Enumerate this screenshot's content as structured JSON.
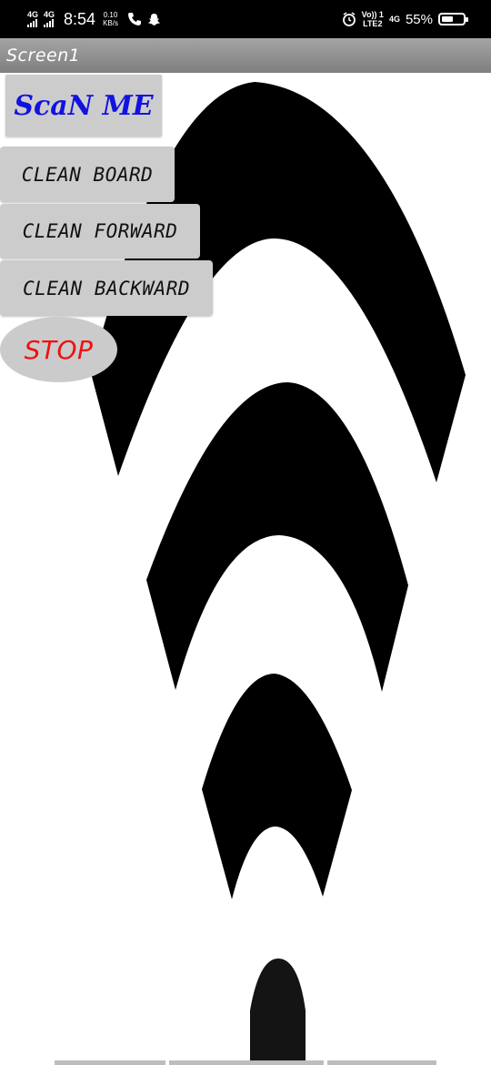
{
  "status_bar": {
    "network_1": "4G",
    "network_2": "4G",
    "time": "8:54",
    "speed_value": "0.10",
    "speed_unit": "KB/s",
    "volte_line1": "Vo)) 1",
    "volte_line2": "LTE2",
    "lte_network": "4G",
    "battery_percent": "55%",
    "battery_level": 0.55
  },
  "title_bar": {
    "title": "Screen1"
  },
  "buttons": {
    "scan": "ScaN ME",
    "clean_board": "CLEAN BOARD",
    "clean_forward": "CLEAN FORWARD",
    "clean_backward": "CLEAN BACKWARD",
    "stop": "STOP"
  },
  "colors": {
    "scan_text": "#1212e0",
    "stop_text": "#ee1111",
    "button_bg": "#cccccc",
    "art": "#000000"
  },
  "background_image": {
    "icon": "wifi-signal-icon"
  }
}
